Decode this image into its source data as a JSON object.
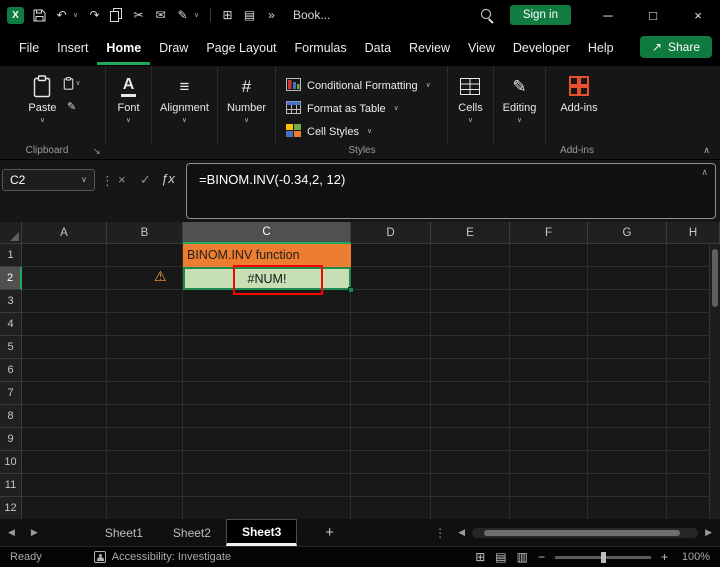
{
  "titlebar": {
    "doc_name": "Book...",
    "sign_in": "Sign in"
  },
  "menu": {
    "items": [
      "File",
      "Insert",
      "Home",
      "Draw",
      "Page Layout",
      "Formulas",
      "Data",
      "Review",
      "View",
      "Developer",
      "Help"
    ],
    "active": "Home",
    "share": "Share"
  },
  "ribbon": {
    "paste": "Paste",
    "font": "Font",
    "alignment": "Alignment",
    "number": "Number",
    "conditional_formatting": "Conditional Formatting",
    "format_as_table": "Format as Table",
    "cell_styles": "Cell Styles",
    "cells": "Cells",
    "editing": "Editing",
    "addins": "Add-ins",
    "groups": {
      "clipboard": "Clipboard",
      "styles": "Styles",
      "addins": "Add-ins"
    }
  },
  "formula_bar": {
    "name_box": "C2",
    "fx": "ƒx",
    "cancel": "×",
    "enter": "✓",
    "formula": "=BINOM.INV(-0.34,2, 12)"
  },
  "grid": {
    "columns": [
      "A",
      "B",
      "C",
      "D",
      "E",
      "F",
      "G",
      "H"
    ],
    "rows": [
      "1",
      "2",
      "3",
      "4",
      "5",
      "6",
      "7",
      "8",
      "9",
      "10",
      "11",
      "12"
    ],
    "selected_cell": "C2",
    "c1_text": "BINOM.INV function",
    "c2_text": "#NUM!",
    "colors": {
      "c1_fill": "#ED7D31",
      "c2_fill": "#C6E0B4",
      "selection_border": "#1F8A4D",
      "error_annotation": "#FF0000",
      "accent_green": "#1EA95C"
    }
  },
  "sheets": {
    "tabs": [
      "Sheet1",
      "Sheet2",
      "Sheet3"
    ],
    "active": "Sheet3"
  },
  "status": {
    "ready": "Ready",
    "accessibility": "Accessibility: Investigate",
    "zoom": "100%"
  },
  "icons": {
    "caret_down": "∨",
    "caret_up": "∧",
    "more": "»",
    "dots_v": "⋮",
    "undo": "↶",
    "redo": "↷",
    "cut": "✂",
    "mail": "✉",
    "pencil": "✎",
    "grid": "⊞",
    "page": "▤",
    "pagebreak": "▥",
    "warning": "⚠",
    "left": "◀",
    "right": "▶",
    "plus": "+",
    "minus": "−",
    "close": "×",
    "maximize": "□",
    "minimize": "─",
    "launcher": "↘",
    "share_arrow": "↗",
    "lines": "≡",
    "hash": "#",
    "font_a": "A",
    "logo_x": "X"
  }
}
